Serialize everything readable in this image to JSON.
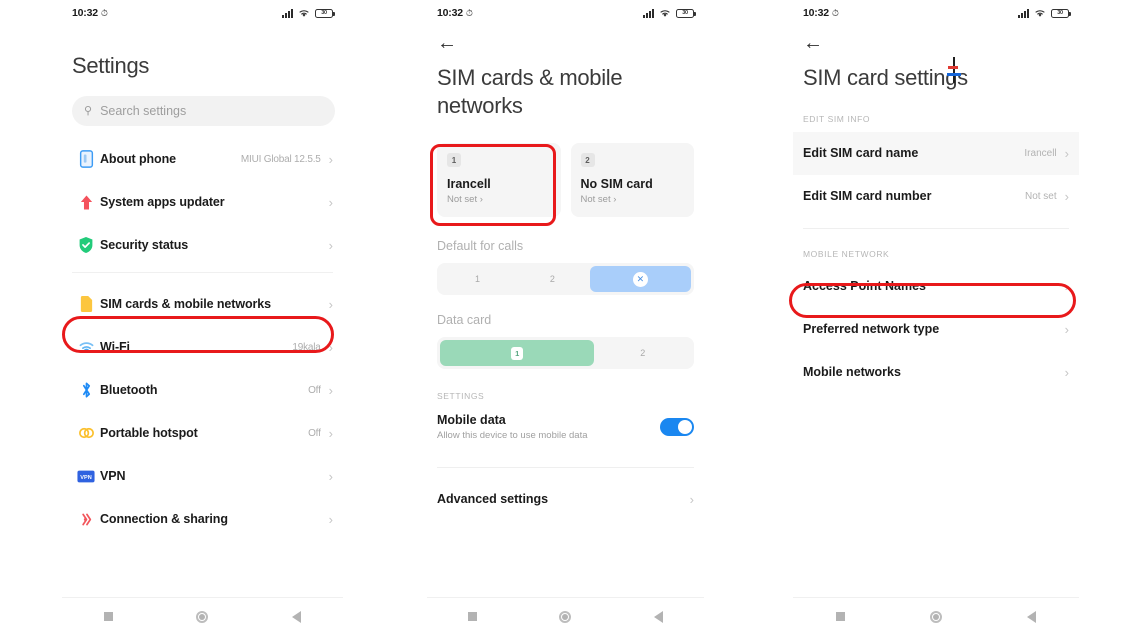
{
  "status_bar": {
    "time": "10:32",
    "alarm_icon": "alarm-icon",
    "signal_icon": "signal-icon",
    "wifi_icon": "wifi-icon",
    "battery_icon": "battery-icon",
    "battery_text": "30"
  },
  "nav_bar": {
    "recents": "recents-square-icon",
    "home": "home-circle-icon",
    "back": "back-triangle-icon"
  },
  "panel1": {
    "title": "Settings",
    "search": {
      "placeholder": "Search settings",
      "icon": "search-icon"
    },
    "rows_top": [
      {
        "icon": "phone-outline-icon",
        "label": "About phone",
        "value": "MIUI Global 12.5.5",
        "chevron": "›"
      },
      {
        "icon": "up-arrow-icon",
        "label": "System apps updater",
        "value": "",
        "chevron": "›"
      },
      {
        "icon": "shield-check-icon",
        "label": "Security status",
        "value": "",
        "chevron": "›"
      }
    ],
    "rows_bottom": [
      {
        "icon": "sim-card-icon",
        "label": "SIM cards & mobile networks",
        "value": "",
        "chevron": "›"
      },
      {
        "icon": "wifi-icon",
        "label": "Wi-Fi",
        "value": "19kala",
        "chevron": "›"
      },
      {
        "icon": "bluetooth-icon",
        "label": "Bluetooth",
        "value": "Off",
        "chevron": "›"
      },
      {
        "icon": "hotspot-icon",
        "label": "Portable hotspot",
        "value": "Off",
        "chevron": "›"
      },
      {
        "icon": "vpn-icon",
        "label": "VPN",
        "value": "",
        "chevron": "›"
      },
      {
        "icon": "connection-sharing-icon",
        "label": "Connection & sharing",
        "value": "",
        "chevron": "›"
      }
    ]
  },
  "panel2": {
    "back_icon": "back-arrow-icon",
    "title": "SIM cards & mobile networks",
    "sim_cards": [
      {
        "badge": "1",
        "name": "Irancell",
        "sub": "Not set ›"
      },
      {
        "badge": "2",
        "name": "No SIM card",
        "sub": "Not set ›"
      }
    ],
    "default_for_calls": {
      "label": "Default for calls",
      "options": [
        "1",
        "2",
        "ask-every-time-icon"
      ],
      "selected_index": 2
    },
    "data_card": {
      "label": "Data card",
      "options": [
        "1",
        "2"
      ],
      "selected_index": 0
    },
    "settings_caption": "SETTINGS",
    "mobile_data": {
      "title": "Mobile data",
      "subtitle": "Allow this device to use mobile data",
      "toggle_on": true
    },
    "advanced": {
      "label": "Advanced settings",
      "chevron": "›"
    }
  },
  "panel3": {
    "back_icon": "back-arrow-icon",
    "title": "SIM card settings",
    "edit_caption": "EDIT SIM INFO",
    "edit_rows": [
      {
        "label": "Edit SIM card name",
        "value": "Irancell",
        "chevron": "›",
        "highlighted": true
      },
      {
        "label": "Edit SIM card number",
        "value": "Not set",
        "chevron": "›",
        "highlighted": false
      }
    ],
    "network_caption": "MOBILE NETWORK",
    "network_rows": [
      {
        "label": "Access Point Names",
        "value": "",
        "chevron": "›"
      },
      {
        "label": "Preferred network type",
        "value": "",
        "chevron": "›"
      },
      {
        "label": "Mobile networks",
        "value": "",
        "chevron": "›"
      }
    ]
  },
  "annotations": {
    "color": "#e8191b",
    "rings": [
      {
        "name": "ring-sim-cards-row"
      },
      {
        "name": "ring-sim1-chip"
      },
      {
        "name": "ring-access-point-names"
      }
    ]
  }
}
